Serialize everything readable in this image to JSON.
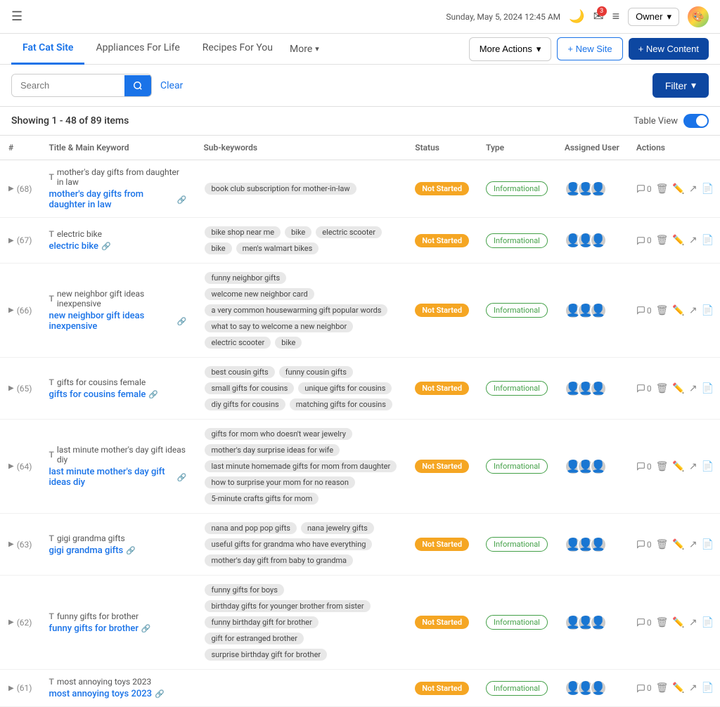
{
  "header": {
    "hamburger": "☰",
    "datetime": "Sunday, May 5, 2024 12:45 AM",
    "moon_icon": "🌙",
    "mail_icon": "✉",
    "mail_badge": "3",
    "lines_icon": "≡",
    "owner_label": "Owner",
    "chevron": "▾"
  },
  "site_tabs": {
    "tabs": [
      {
        "label": "Fat Cat Site",
        "active": true
      },
      {
        "label": "Appliances For Life",
        "active": false
      },
      {
        "label": "Recipes For You",
        "active": false
      }
    ],
    "more_label": "More",
    "more_actions_label": "More Actions",
    "new_site_label": "+ New Site",
    "new_content_label": "+ New Content"
  },
  "search_bar": {
    "placeholder": "Search",
    "search_label": "Search",
    "clear_label": "Clear",
    "filter_label": "Filter",
    "filter_chevron": "▾"
  },
  "showing": {
    "text": "Showing 1 - 48 of 89 items",
    "table_view_label": "Table View"
  },
  "table": {
    "columns": [
      "#",
      "Title & Main Keyword",
      "Sub-keywords",
      "Status",
      "Type",
      "Assigned User",
      "Actions"
    ],
    "rows": [
      {
        "num": "(68)",
        "title_label": "mother's day gifts from daughter in law",
        "title_link": "mother's day gifts from daughter in law",
        "sub_keywords": [
          "book club subscription for mother-in-law"
        ],
        "status": "Not Started",
        "type": "Informational",
        "comments": "0"
      },
      {
        "num": "(67)",
        "title_label": "electric bike",
        "title_link": "electric bike",
        "sub_keywords": [
          "bike shop near me",
          "bike",
          "electric scooter",
          "bike",
          "men's walmart bikes"
        ],
        "status": "Not Started",
        "type": "Informational",
        "comments": "0"
      },
      {
        "num": "(66)",
        "title_label": "new neighbor gift ideas inexpensive",
        "title_link": "new neighbor gift ideas inexpensive",
        "sub_keywords": [
          "funny neighbor gifts",
          "welcome new neighbor card",
          "a very common housewarming gift popular words",
          "what to say to welcome a new neighbor",
          "electric scooter",
          "bike"
        ],
        "status": "Not Started",
        "type": "Informational",
        "comments": "0"
      },
      {
        "num": "(65)",
        "title_label": "gifts for cousins female",
        "title_link": "gifts for cousins female",
        "sub_keywords": [
          "best cousin gifts",
          "funny cousin gifts",
          "small gifts for cousins",
          "unique gifts for cousins",
          "diy gifts for cousins",
          "matching gifts for cousins"
        ],
        "status": "Not Started",
        "type": "Informational",
        "comments": "0"
      },
      {
        "num": "(64)",
        "title_label": "last minute mother's day gift ideas diy",
        "title_link": "last minute mother's day gift ideas diy",
        "sub_keywords": [
          "gifts for mom who doesn't wear jewelry",
          "mother's day surprise ideas for wife",
          "last minute homemade gifts for mom from daughter",
          "how to surprise your mom for no reason",
          "5-minute crafts gifts for mom"
        ],
        "status": "Not Started",
        "type": "Informational",
        "comments": "0"
      },
      {
        "num": "(63)",
        "title_label": "gigi grandma gifts",
        "title_link": "gigi grandma gifts",
        "sub_keywords": [
          "nana and pop pop gifts",
          "nana jewelry gifts",
          "useful gifts for grandma who have everything",
          "mother's day gift from baby to grandma"
        ],
        "status": "Not Started",
        "type": "Informational",
        "comments": "0"
      },
      {
        "num": "(62)",
        "title_label": "funny gifts for brother",
        "title_link": "funny gifts for brother",
        "sub_keywords": [
          "funny gifts for boys",
          "birthday gifts for younger brother from sister",
          "funny birthday gift for brother",
          "gift for estranged brother",
          "surprise birthday gift for brother"
        ],
        "status": "Not Started",
        "type": "Informational",
        "comments": "0"
      },
      {
        "num": "(61)",
        "title_label": "most annoying toys 2023",
        "title_link": "most annoying toys 2023",
        "sub_keywords": [],
        "status": "Not Started",
        "type": "Informational",
        "comments": "0"
      }
    ]
  }
}
